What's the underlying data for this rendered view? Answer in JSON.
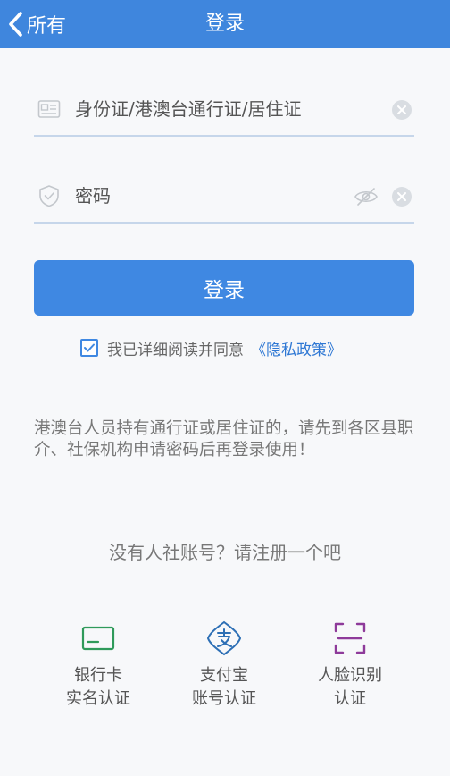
{
  "header": {
    "back_label": "所有",
    "title": "登录"
  },
  "form": {
    "id_placeholder": "身份证/港澳台通行证/居住证",
    "password_placeholder": "密码",
    "login_label": "登录"
  },
  "agreement": {
    "checked": true,
    "text": "我已详细阅读并同意",
    "policy_link": "《隐私政策》"
  },
  "notice": "港澳台人员持有通行证或居住证的，请先到各区县职介、社保机构申请密码后再登录使用！",
  "register_prompt": "没有人社账号？请注册一个吧",
  "auth_options": [
    {
      "line1": "银行卡",
      "line2": "实名认证",
      "icon": "bank-card-icon"
    },
    {
      "line1": "支付宝",
      "line2": "账号认证",
      "icon": "alipay-icon"
    },
    {
      "line1": "人脸识别",
      "line2": "认证",
      "icon": "face-scan-icon"
    }
  ],
  "colors": {
    "header": "#3f86dd",
    "primary_button": "#3f88e2",
    "link": "#2f78d4",
    "bank_icon": "#2f9a5a",
    "alipay_icon": "#2d6fb5",
    "face_icon": "#8e3a9a"
  }
}
